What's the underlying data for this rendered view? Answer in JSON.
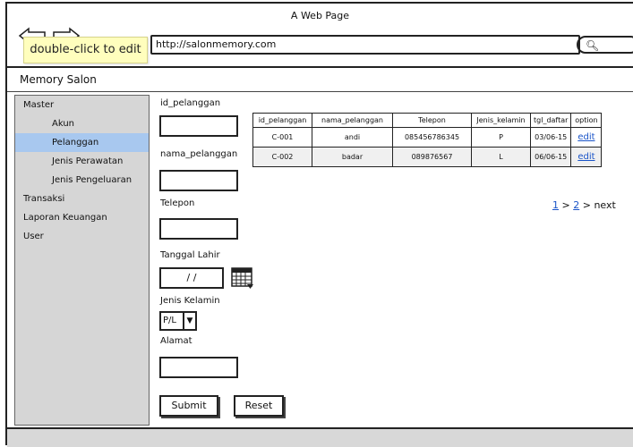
{
  "window": {
    "title": "A Web Page",
    "url": "http://salonmemory.com",
    "tooltip": "double-click to edit"
  },
  "site": {
    "title": "Memory Salon"
  },
  "sidebar": {
    "items": [
      {
        "label": "Master",
        "level": 0,
        "active": false
      },
      {
        "label": "Akun",
        "level": 1,
        "active": false
      },
      {
        "label": "Pelanggan",
        "level": 1,
        "active": true
      },
      {
        "label": "Jenis Perawatan",
        "level": 1,
        "active": false
      },
      {
        "label": "Jenis Pengeluaran",
        "level": 1,
        "active": false
      },
      {
        "label": "Transaksi",
        "level": 0,
        "active": false
      },
      {
        "label": "Laporan Keuangan",
        "level": 0,
        "active": false
      },
      {
        "label": "User",
        "level": 0,
        "active": false
      }
    ]
  },
  "form": {
    "id_label": "id_pelanggan",
    "nama_label": "nama_pelanggan",
    "telepon_label": "Telepon",
    "tgl_label": "Tanggal Lahir",
    "tgl_value": "/ /",
    "jk_label": "Jenis Kelamin",
    "jk_value": "P/L",
    "alamat_label": "Alamat",
    "submit_label": "Submit",
    "reset_label": "Reset"
  },
  "table": {
    "headers": [
      "id_pelanggan",
      "nama_pelanggan",
      "Telepon",
      "Jenis_kelamin",
      "tgl_daftar",
      "option"
    ],
    "rows": [
      {
        "id": "C-001",
        "nama": "andi",
        "telepon": "085456786345",
        "jk": "P",
        "tgl": "03/06-15",
        "option": "edit"
      },
      {
        "id": "C-002",
        "nama": "badar",
        "telepon": "089876567",
        "jk": "L",
        "tgl": "06/06-15",
        "option": "edit"
      }
    ]
  },
  "pager": {
    "page1": "1",
    "sep1": ">",
    "page2": "2",
    "sep2": ">",
    "next": "next"
  },
  "colors": {
    "sidebar_bg": "#d6d6d6",
    "active_item": "#a8c8ef",
    "link": "#1a54c8",
    "tooltip_bg": "#fffebd"
  }
}
